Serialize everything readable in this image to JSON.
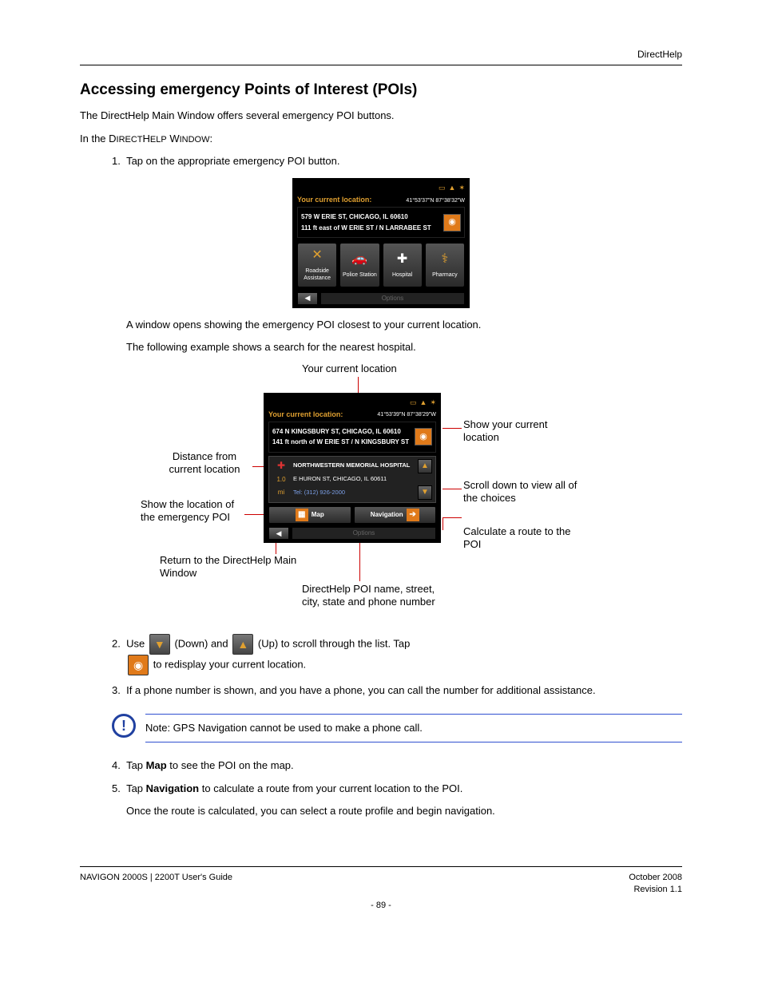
{
  "header_right": "DirectHelp",
  "h_intro": "Accessing emergency Points of Interest (POIs)",
  "intro": "The DirectHelp Main Window offers several emergency POI buttons.",
  "intro2_a": "In the D",
  "intro2_b": "IRECT",
  "intro2_c": "H",
  "intro2_d": "ELP",
  "intro2_e": " W",
  "intro2_f": "INDOW",
  "intro2_g": ":",
  "step1a": "1.",
  "step1b": "Tap on the appropriate emergency POI button.",
  "device1": {
    "loc_label": "Your current location:",
    "coords": "41°53'37\"N  87°38'32\"W",
    "addr1": "579 W ERIE ST, CHICAGO, IL 60610",
    "addr2": "111 ft east of W ERIE ST / N LARRABEE ST",
    "p1": "Roadside Assistance",
    "p2": "Police Station",
    "p3": "Hospital",
    "p4": "Pharmacy",
    "options": "Options"
  },
  "after1a": "A window opens showing the emergency POI closest to your current location.",
  "after1b": "The following example shows a search for the nearest hospital.",
  "device2": {
    "loc_label": "Your current location:",
    "coords": "41°53'39\"N  87°38'29\"W",
    "addr1": "674 N KINGSBURY ST, CHICAGO, IL 60610",
    "addr2": "141 ft north of W ERIE ST / N KINGSBURY ST",
    "name": "NORTHWESTERN MEMORIAL HOSPITAL",
    "dist_val": "1.0",
    "dist_unit": "mi",
    "street": "E HURON ST, CHICAGO, IL 60611",
    "tel_lbl": "Tel:",
    "tel": "(312) 926-2000",
    "map": "Map",
    "nav": "Navigation",
    "options": "Options"
  },
  "callouts": {
    "top": "Your current location",
    "r1": "Show your current location",
    "r2": "Scroll down to view all of the choices",
    "r3": "Calculate a route to the POI",
    "l1": "Distance from current location",
    "l2": "Show the location of the emergency POI",
    "l3": "Return to the DirectHelp Main Window",
    "b1": "DirectHelp POI name, street, city, state and phone number"
  },
  "step2a": "2.",
  "step2b_a": "Use ",
  "step2b_b": " (Down) and ",
  "step2b_c": " (Up) to scroll through the list. Tap",
  "step2c": " to redisplay your current location.",
  "step3a": "3.",
  "step3b": "If a phone number is shown, and you have a phone, you can call the number for additional assistance.",
  "note": "Note: GPS Navigation cannot be used to make a phone call.",
  "step4a": "4.",
  "step4b_1": "Tap ",
  "step4b_bold": "Map",
  "step4b_2": " to see the POI on the map.",
  "step5a": "5.",
  "step5b_1": "Tap ",
  "step5b_bold": "Navigation",
  "step5b_2": " to calculate a route from your current location to the POI.",
  "step5c": "Once the route is calculated, you can select a route profile and begin navigation.",
  "footer_left": "NAVIGON 2000S | 2200T User's Guide",
  "footer_right_a": "October 2008",
  "footer_right_b": "Revision 1.1",
  "page_num": "- 89 -"
}
